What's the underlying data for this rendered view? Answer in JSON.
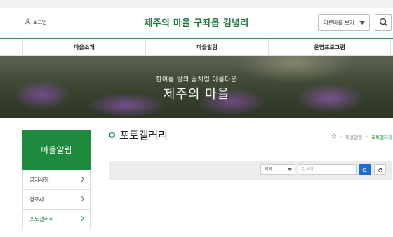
{
  "header": {
    "login_label": "로그인",
    "site_title": "제주의 마을 구좌읍 김녕리",
    "village_select": "다른마을 보기"
  },
  "gnb": {
    "items": [
      {
        "label": "마을소개"
      },
      {
        "label": "마을알림"
      },
      {
        "label": "운영프로그램"
      }
    ]
  },
  "hero": {
    "subtitle": "한여름 밤의 꿈처럼 아름다운",
    "title": "제주의 마을"
  },
  "lnb": {
    "heading": "마을알림",
    "items": [
      {
        "label": "공지사항",
        "active": false
      },
      {
        "label": "경조사",
        "active": false
      },
      {
        "label": "포토갤러리",
        "active": true
      }
    ]
  },
  "content": {
    "page_title": "포토갤러리",
    "breadcrumb": [
      "마을알림",
      "포토갤러리"
    ]
  },
  "search": {
    "field_selected": "제목",
    "keyword_placeholder": "검색어"
  },
  "colors": {
    "brand_green": "#1f8a3d",
    "search_blue": "#1e6ad6"
  }
}
